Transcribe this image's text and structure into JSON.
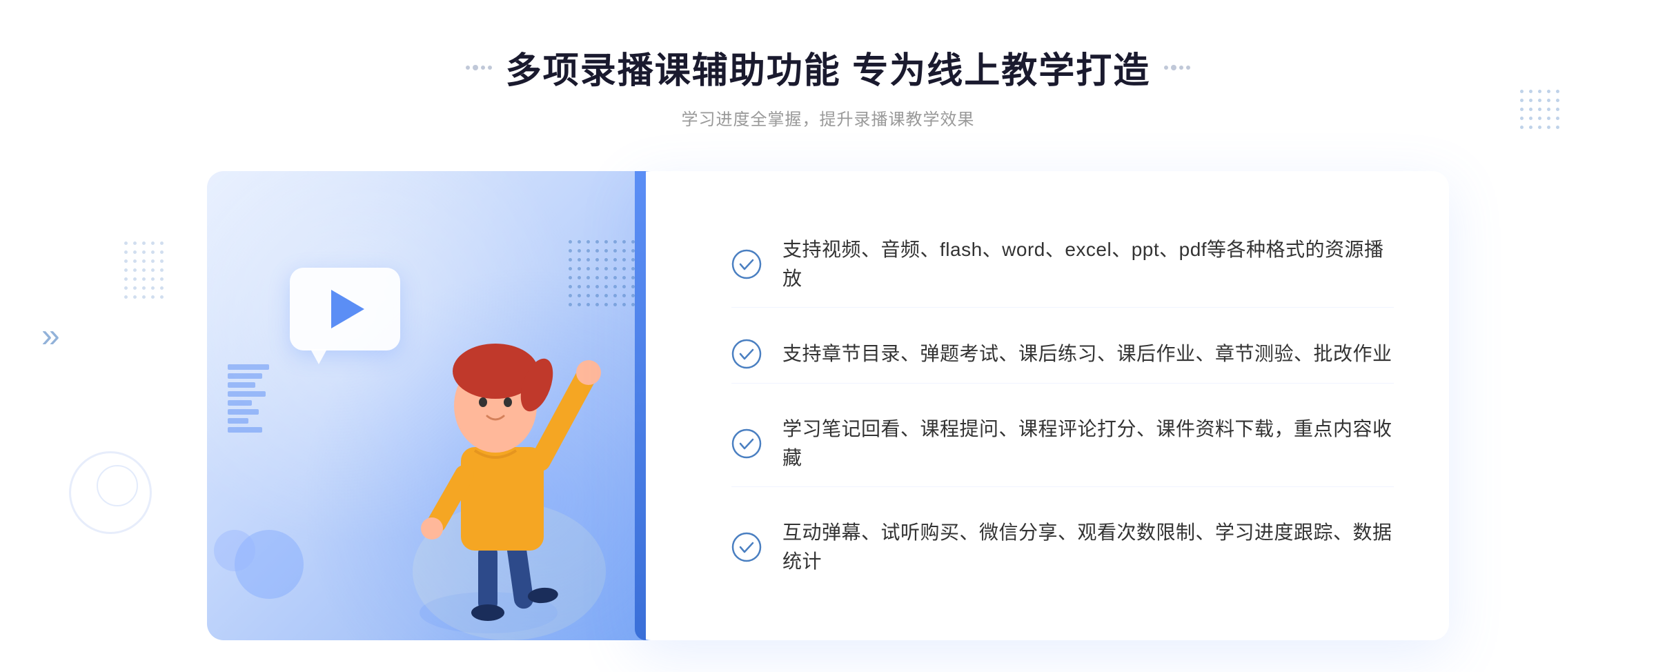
{
  "header": {
    "title": "多项录播课辅助功能 专为线上教学打造",
    "subtitle": "学习进度全掌握，提升录播课教学效果"
  },
  "features": [
    {
      "id": "feature-1",
      "text": "支持视频、音频、flash、word、excel、ppt、pdf等各种格式的资源播放"
    },
    {
      "id": "feature-2",
      "text": "支持章节目录、弹题考试、课后练习、课后作业、章节测验、批改作业"
    },
    {
      "id": "feature-3",
      "text": "学习笔记回看、课程提问、课程评论打分、课件资料下载，重点内容收藏"
    },
    {
      "id": "feature-4",
      "text": "互动弹幕、试听购买、微信分享、观看次数限制、学习进度跟踪、数据统计"
    }
  ],
  "colors": {
    "accent": "#4a7fc1",
    "title": "#1a1a2e",
    "subtitle": "#999999",
    "feature_text": "#333333",
    "check_color": "#4a7fc1"
  },
  "icons": {
    "check": "check-circle",
    "play": "play-triangle",
    "chevron": "chevron-left"
  },
  "decorations": {
    "dots_count_grid": 80,
    "chevron_label": "«"
  }
}
